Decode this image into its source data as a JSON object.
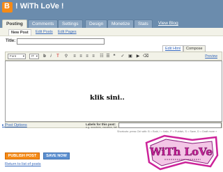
{
  "header": {
    "blog_title": "! WiTh LoVe !"
  },
  "tabs": [
    {
      "label": "Posting"
    },
    {
      "label": "Comments"
    },
    {
      "label": "Settings"
    },
    {
      "label": "Design"
    },
    {
      "label": "Monetize"
    },
    {
      "label": "Stats"
    },
    {
      "label": "View Blog"
    }
  ],
  "subtabs": [
    {
      "label": "New Post"
    },
    {
      "label": "Edit Posts"
    },
    {
      "label": "Edit Pages"
    }
  ],
  "form": {
    "title_label": "Title:",
    "title_value": ""
  },
  "editor_modes": {
    "html": "Edit Html",
    "compose": "Compose"
  },
  "toolbar": {
    "font": "Font",
    "size": "tT",
    "preview": "Preview"
  },
  "editor": {
    "content": "klik sini.."
  },
  "bottom": {
    "post_options": "Post Options",
    "labels_label": "Labels for this post:",
    "labels_hint": "e.g. scooters, vacation, fall",
    "shortcuts": "Shortcuts: press Ctrl with: B = Bold, I = Italic, P = Publish, S = Save, D = Draft more »"
  },
  "actions": {
    "publish": "PUBLISH POST",
    "save": "SAVE NOW",
    "return": "Return to list of posts"
  },
  "overlay": {
    "text": "WiTh LoVe"
  },
  "colors": {
    "header": "#6b8cad",
    "publish": "#f58a16",
    "save": "#5b8fd0",
    "link": "#3366bb",
    "overlay": "#cc2299"
  }
}
